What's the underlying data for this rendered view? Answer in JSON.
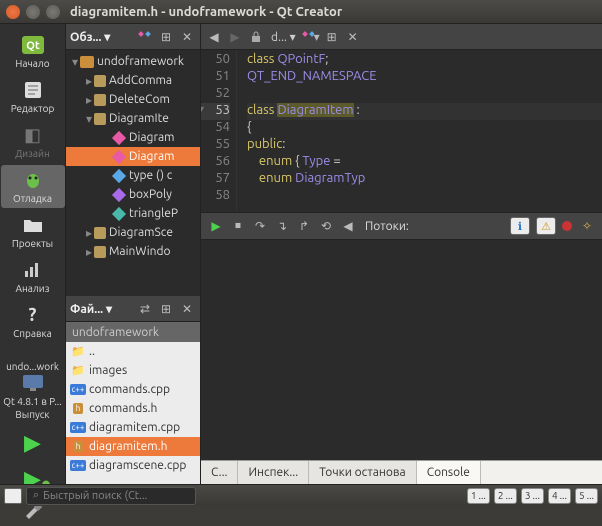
{
  "window": {
    "title": "diagramitem.h - undoframework - Qt Creator"
  },
  "modes": {
    "welcome": "Начало",
    "editor": "Редактор",
    "design": "Дизайн",
    "debug": "Отладка",
    "projects": "Проекты",
    "analyze": "Анализ",
    "help": "Справка"
  },
  "kit": {
    "project": "undo...work",
    "label": "Qt 4.8.1 в P...",
    "sub": "Выпуск"
  },
  "outline": {
    "title": "Обз... ▾",
    "root": "undoframework",
    "items": [
      {
        "label": "AddComma",
        "ic": "class"
      },
      {
        "label": "DeleteCom",
        "ic": "class"
      },
      {
        "label": "DiagramIte",
        "ic": "class",
        "expanded": true
      },
      {
        "label": "Diagram",
        "ic": "d-pink"
      },
      {
        "label": "Diagram",
        "ic": "d-pink",
        "sel": true
      },
      {
        "label": "type () c",
        "ic": "d-blue"
      },
      {
        "label": "boxPoly",
        "ic": "d-purple"
      },
      {
        "label": "triangleP",
        "ic": "d-teal"
      },
      {
        "label": "DiagramSce",
        "ic": "class"
      },
      {
        "label": "MainWindo",
        "ic": "class"
      }
    ]
  },
  "editor": {
    "tab": "d... ▾",
    "lines": [
      {
        "n": 50,
        "html": "<span class='kw'>class</span> <span class='ty'>QPointF</span>;"
      },
      {
        "n": 51,
        "html": "<span class='pp'>QT_END_NAMESPACE</span>"
      },
      {
        "n": 52,
        "html": ""
      },
      {
        "n": 53,
        "html": "<span class='kw'>class</span> <span class='ty tok-hi'>DiagramItem</span> :",
        "cur": true
      },
      {
        "n": 54,
        "html": "{"
      },
      {
        "n": 55,
        "html": "<span class='kw'>public</span>:"
      },
      {
        "n": 56,
        "html": "    <span class='kw'>enum</span> { <span class='ty'>Type</span> = "
      },
      {
        "n": 57,
        "html": "    <span class='kw'>enum</span> <span class='ty'>DiagramTyp</span>"
      },
      {
        "n": 58,
        "html": ""
      }
    ]
  },
  "debug": {
    "threads": "Потоки:"
  },
  "debug_tabs": {
    "t1": "С...",
    "t2": "Инспек...",
    "t3": "Точки останова",
    "t4": "Console"
  },
  "files": {
    "title": "Фай... ▾",
    "crumb": "undoframework",
    "items": [
      {
        "label": "..",
        "ic": "folder"
      },
      {
        "label": "images",
        "ic": "folder"
      },
      {
        "label": "commands.cpp",
        "ic": "cpp"
      },
      {
        "label": "commands.h",
        "ic": "h"
      },
      {
        "label": "diagramitem.cpp",
        "ic": "cpp"
      },
      {
        "label": "diagramitem.h",
        "ic": "h",
        "sel": true
      },
      {
        "label": "diagramscene.cpp",
        "ic": "cpp"
      }
    ]
  },
  "status": {
    "search": "Быстрый поиск (Ct...",
    "b1": "1",
    "e1": "...",
    "b2": "2",
    "e2": "...",
    "b3": "3",
    "e3": "...",
    "b4": "4",
    "e4": "...",
    "b5": "5",
    "e5": "..."
  }
}
